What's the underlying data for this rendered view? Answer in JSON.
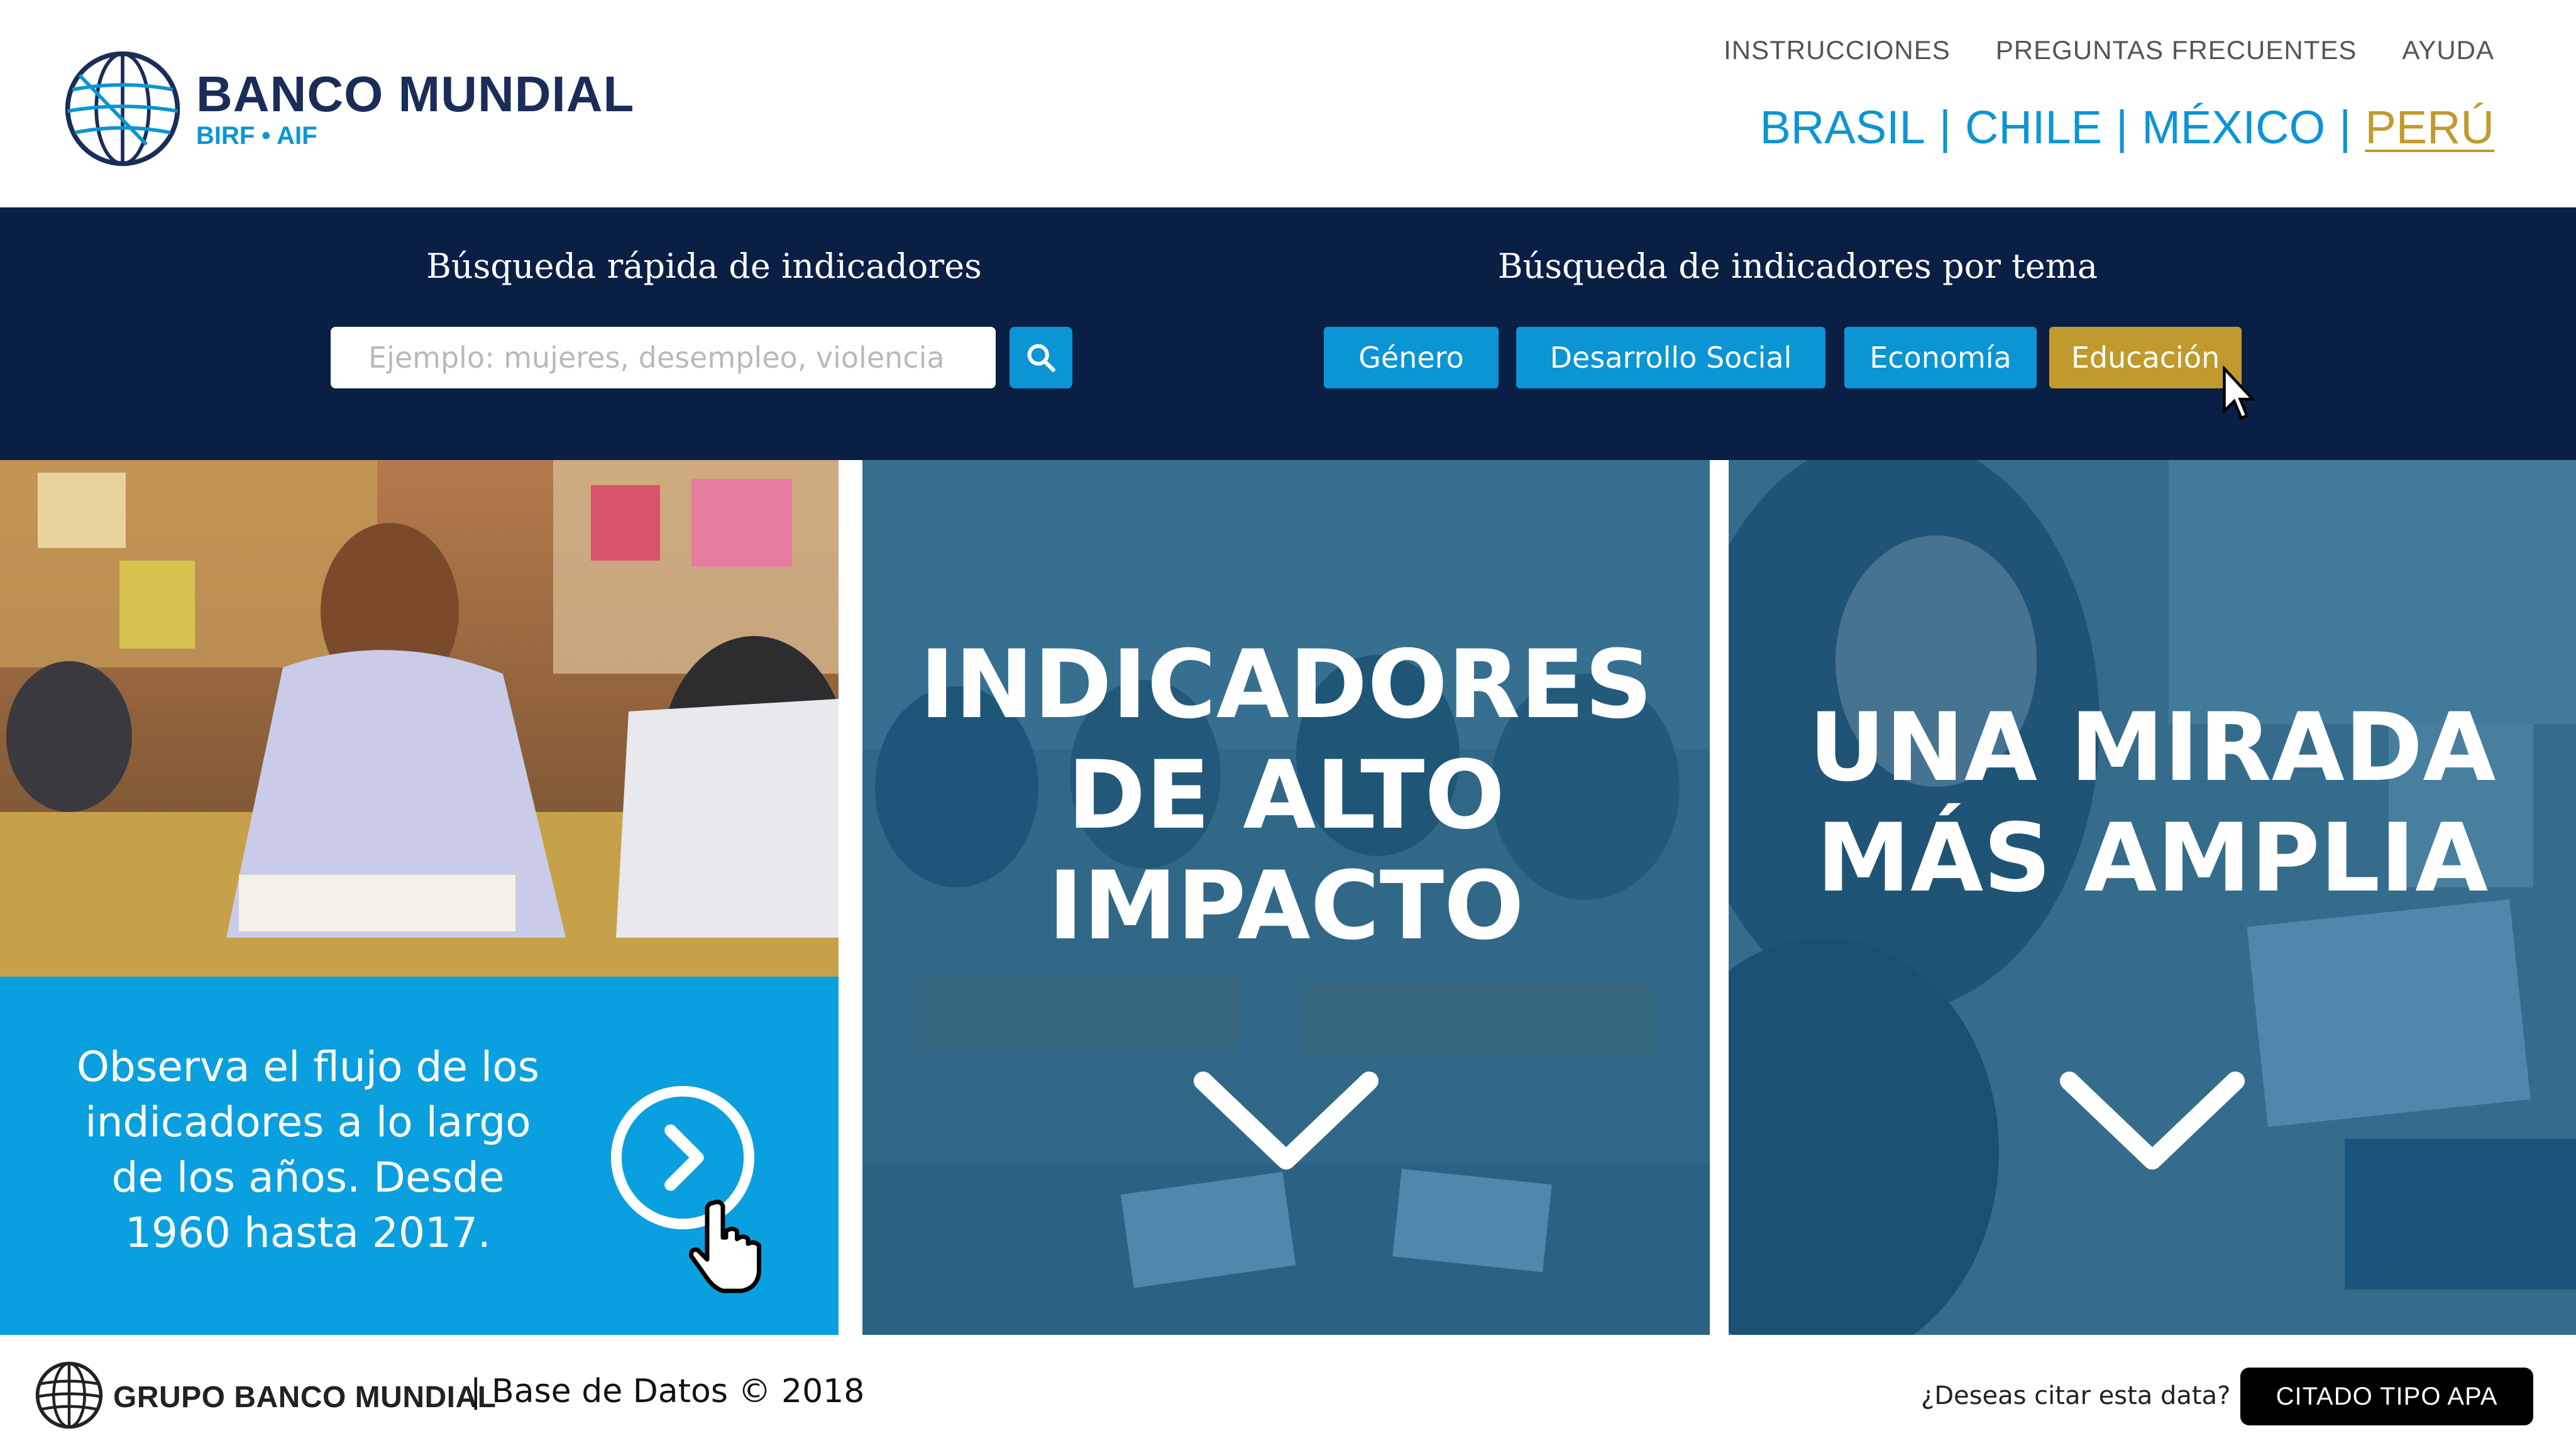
{
  "header": {
    "logo_title": "BANCO MUNDIAL",
    "logo_sub": "BIRF • AIF",
    "nav": [
      "INSTRUCCIONES",
      "PREGUNTAS FRECUENTES",
      "AYUDA"
    ],
    "countries": [
      "BRASIL",
      "CHILE",
      "MÉXICO",
      "PERÚ"
    ],
    "country_separator": "|",
    "active_country": "PERÚ"
  },
  "search": {
    "quick_title": "Búsqueda rápida de indicadores",
    "placeholder": "Ejemplo: mujeres, desempleo, violencia",
    "topic_title": "Búsqueda de indicadores por tema",
    "topics": [
      "Género",
      "Desarrollo Social",
      "Economía",
      "Educación"
    ],
    "active_topic": "Educación"
  },
  "panels": {
    "flow_text": "Observa el flujo de los indicadores a lo largo de los años. Desde 1960 hasta 2017.",
    "panel2_lines": [
      "INDICADORES",
      "DE ALTO",
      "IMPACTO"
    ],
    "panel3_lines": [
      "UNA MIRADA",
      "MÁS AMPLIA"
    ]
  },
  "footer": {
    "brand": "GRUPO BANCO MUNDIAL",
    "db_text": "| Base de Datos © 2018",
    "cite_question": "¿Deseas citar esta data?",
    "cite_button": "CITADO TIPO APA"
  },
  "colors": {
    "navy": "#0a1f44",
    "brand_blue": "#0b95d4",
    "gold": "#c19a2e",
    "logo_navy": "#1a2d59"
  },
  "icons": [
    "globe-logo-icon",
    "search-icon",
    "pointer-cursor-icon",
    "chevron-right-circle-icon",
    "hand-cursor-icon",
    "chevron-down-icon"
  ]
}
